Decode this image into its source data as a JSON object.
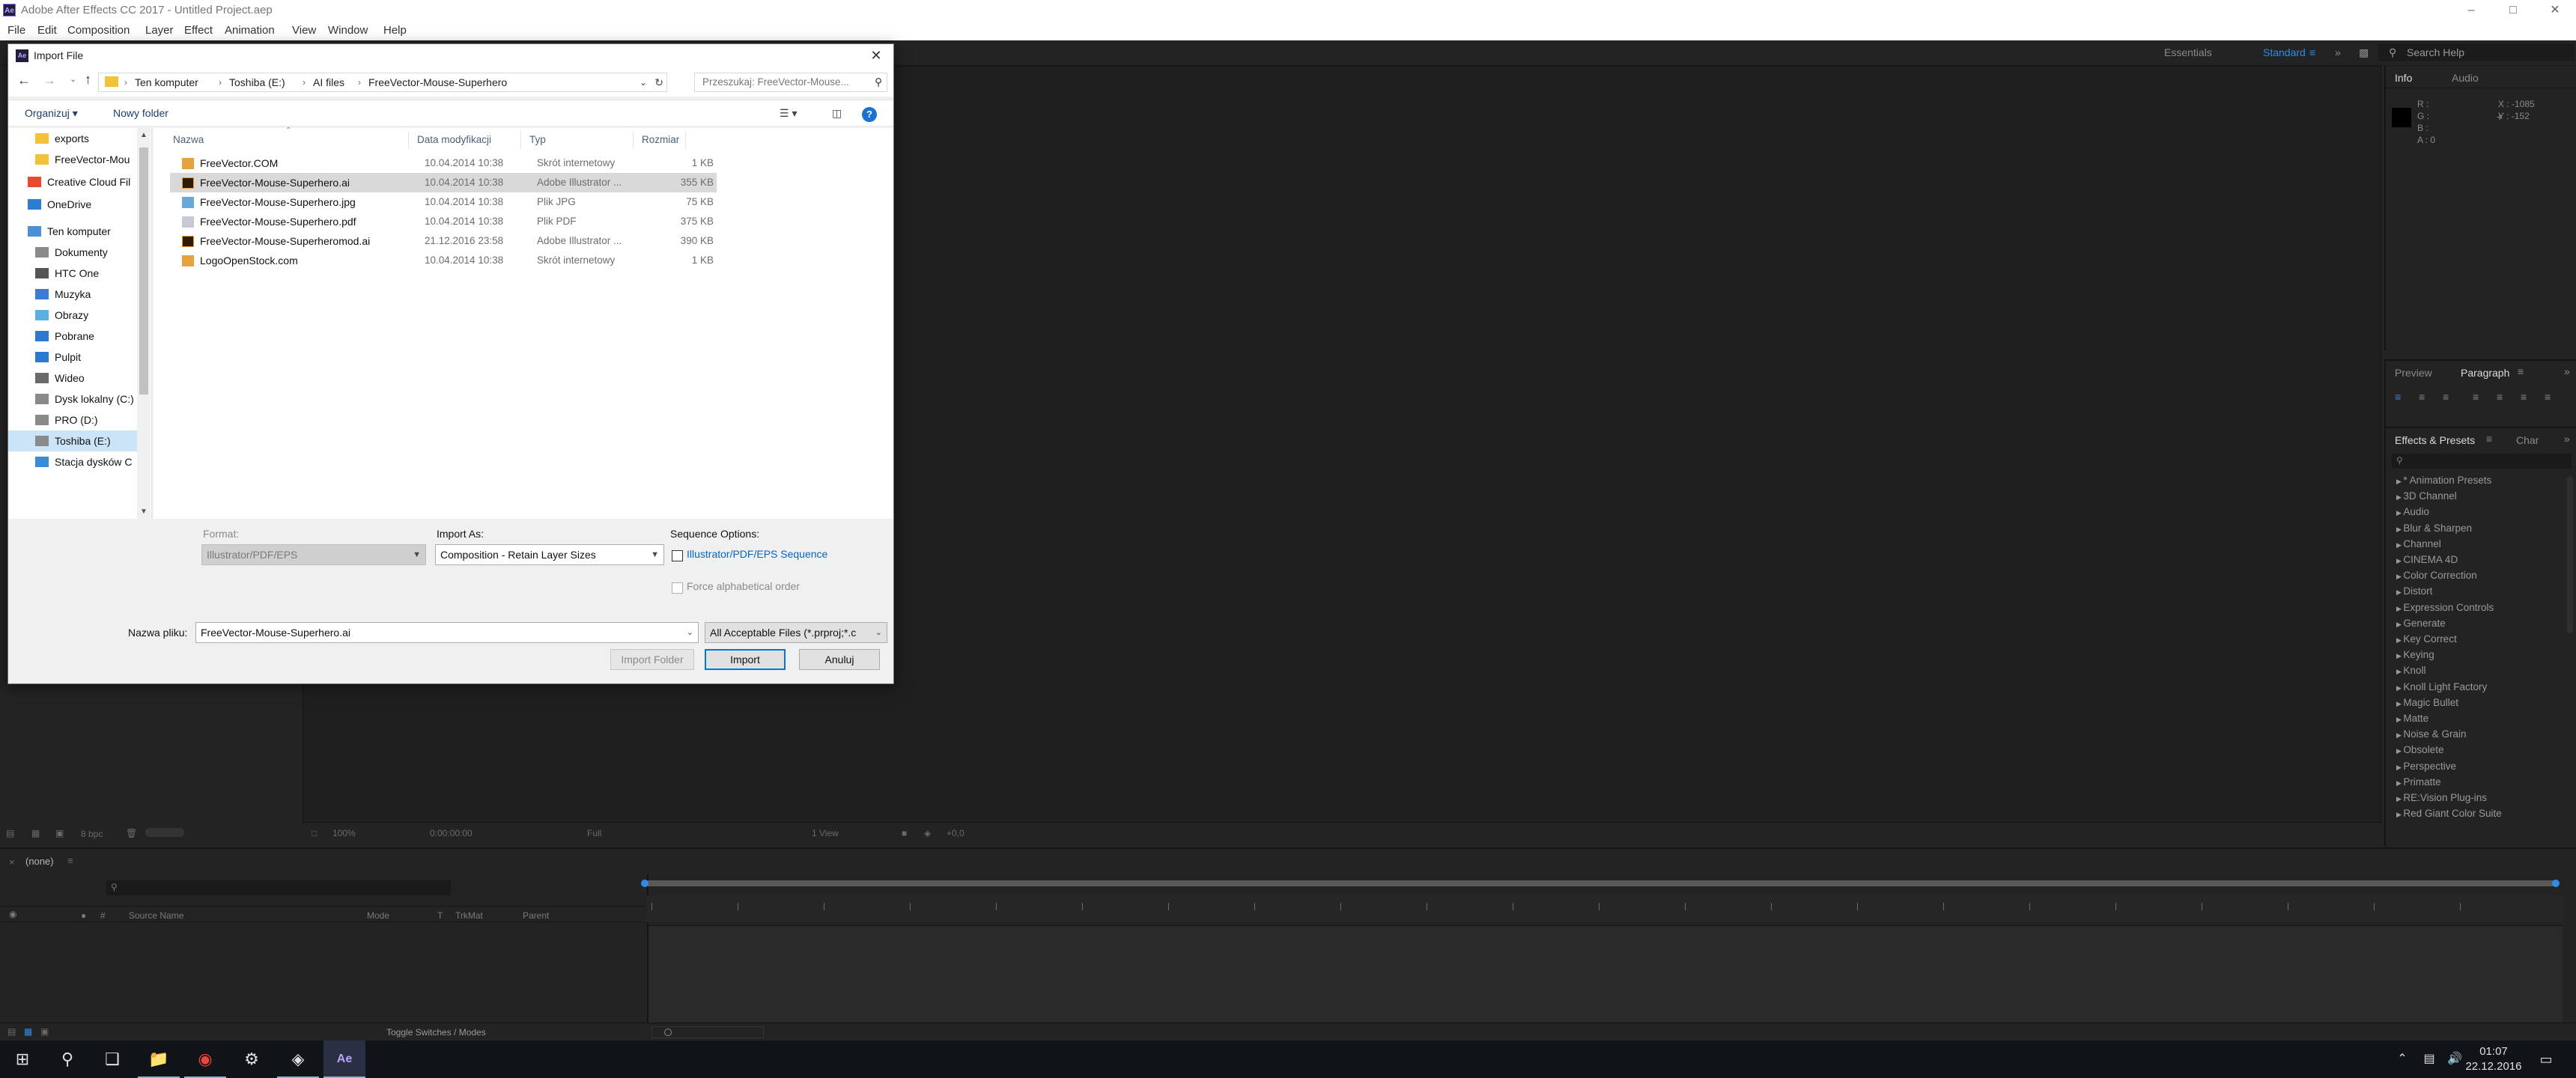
{
  "app": {
    "title": "Adobe After Effects CC 2017 - Untitled Project.aep",
    "logo": "Ae",
    "menu": [
      "File",
      "Edit",
      "Composition",
      "Layer",
      "Effect",
      "Animation",
      "View",
      "Window",
      "Help"
    ],
    "workspaces": [
      "Essentials",
      "Standard"
    ],
    "help_placeholder": "Search Help"
  },
  "info_panel": {
    "tabs": [
      "Info",
      "Audio"
    ],
    "rgba": [
      "R :",
      "G :",
      "B :",
      "A : 0"
    ],
    "coords": [
      "X : -1085",
      "Y : -152"
    ]
  },
  "paragraph_panel": {
    "tabs": [
      "Preview",
      "Paragraph"
    ]
  },
  "effects_panel": {
    "tabs": [
      "Effects & Presets",
      "Char"
    ],
    "items": [
      "* Animation Presets",
      "3D Channel",
      "Audio",
      "Blur & Sharpen",
      "Channel",
      "CINEMA 4D",
      "Color Correction",
      "Distort",
      "Expression Controls",
      "Generate",
      "Key Correct",
      "Keying",
      "Knoll",
      "Knoll Light Factory",
      "Magic Bullet",
      "Matte",
      "Noise & Grain",
      "Obsolete",
      "Perspective",
      "Primatte",
      "RE:Vision Plug-ins",
      "Red Giant Color Suite"
    ]
  },
  "project_footer": {
    "bpc": "8 bpc"
  },
  "comp_footer": {
    "zoom": "100%",
    "timecode": "0:00:00:00",
    "res": "Full",
    "views": "1 View",
    "offset": "+0,0"
  },
  "timeline": {
    "comp_name": "(none)",
    "columns": [
      "#",
      "Source Name",
      "Mode",
      "T",
      "TrkMat",
      "Parent"
    ],
    "toggle_label": "Toggle Switches / Modes"
  },
  "taskbar": {
    "time": "01:07",
    "date": "22.12.2016"
  },
  "dialog": {
    "title": "Import File",
    "breadcrumb": [
      "Ten komputer",
      "Toshiba (E:)",
      "AI files",
      "FreeVector-Mouse-Superhero"
    ],
    "search_placeholder": "Przeszukaj: FreeVector-Mouse...",
    "organize": "Organizuj",
    "new_folder": "Nowy folder",
    "nav": [
      {
        "label": "exports",
        "icon": "folder-icon"
      },
      {
        "label": "FreeVector-Mou",
        "icon": "folder-icon"
      },
      {
        "label": "Creative Cloud Fil",
        "icon": "creative-cloud-icon"
      },
      {
        "label": "OneDrive",
        "icon": "onedrive-icon"
      },
      {
        "label": "Ten komputer",
        "icon": "computer-icon"
      },
      {
        "label": "Dokumenty",
        "icon": "documents-icon"
      },
      {
        "label": "HTC One",
        "icon": "phone-icon"
      },
      {
        "label": "Muzyka",
        "icon": "music-icon"
      },
      {
        "label": "Obrazy",
        "icon": "pictures-icon"
      },
      {
        "label": "Pobrane",
        "icon": "downloads-icon"
      },
      {
        "label": "Pulpit",
        "icon": "desktop-icon"
      },
      {
        "label": "Wideo",
        "icon": "video-icon"
      },
      {
        "label": "Dysk lokalny (C:)",
        "icon": "drive-icon"
      },
      {
        "label": "PRO (D:)",
        "icon": "drive-icon"
      },
      {
        "label": "Toshiba (E:)",
        "icon": "drive-icon"
      },
      {
        "label": "Stacja dysków C",
        "icon": "dvd-drive-icon"
      }
    ],
    "columns": [
      "Nazwa",
      "Data modyfikacji",
      "Typ",
      "Rozmiar"
    ],
    "files": [
      {
        "name": "FreeVector.COM",
        "date": "10.04.2014 10:38",
        "type": "Skrót internetowy",
        "size": "1 KB",
        "icon": "internet-shortcut-icon"
      },
      {
        "name": "FreeVector-Mouse-Superhero.ai",
        "date": "10.04.2014 10:38",
        "type": "Adobe Illustrator ...",
        "size": "355 KB",
        "icon": "illustrator-file-icon"
      },
      {
        "name": "FreeVector-Mouse-Superhero.jpg",
        "date": "10.04.2014 10:38",
        "type": "Plik JPG",
        "size": "75 KB",
        "icon": "image-file-icon"
      },
      {
        "name": "FreeVector-Mouse-Superhero.pdf",
        "date": "10.04.2014 10:38",
        "type": "Plik PDF",
        "size": "375 KB",
        "icon": "pdf-file-icon"
      },
      {
        "name": "FreeVector-Mouse-Superheromod.ai",
        "date": "21.12.2016 23:58",
        "type": "Adobe Illustrator ...",
        "size": "390 KB",
        "icon": "illustrator-file-icon"
      },
      {
        "name": "LogoOpenStock.com",
        "date": "10.04.2014 10:38",
        "type": "Skrót internetowy",
        "size": "1 KB",
        "icon": "internet-shortcut-icon"
      }
    ],
    "format_label": "Format:",
    "format_value": "Illustrator/PDF/EPS",
    "import_as_label": "Import As:",
    "import_as_value": "Composition - Retain Layer Sizes",
    "sequence_label": "Sequence Options:",
    "sequence_option": "Illustrator/PDF/EPS Sequence",
    "force_alpha": "Force alphabetical order",
    "filename_label": "Nazwa pliku:",
    "filename_value": "FreeVector-Mouse-Superhero.ai",
    "filter_value": "All Acceptable Files (*.prproj;*.c",
    "import_folder_btn": "Import Folder",
    "import_btn": "Import",
    "cancel_btn": "Anuluj"
  }
}
